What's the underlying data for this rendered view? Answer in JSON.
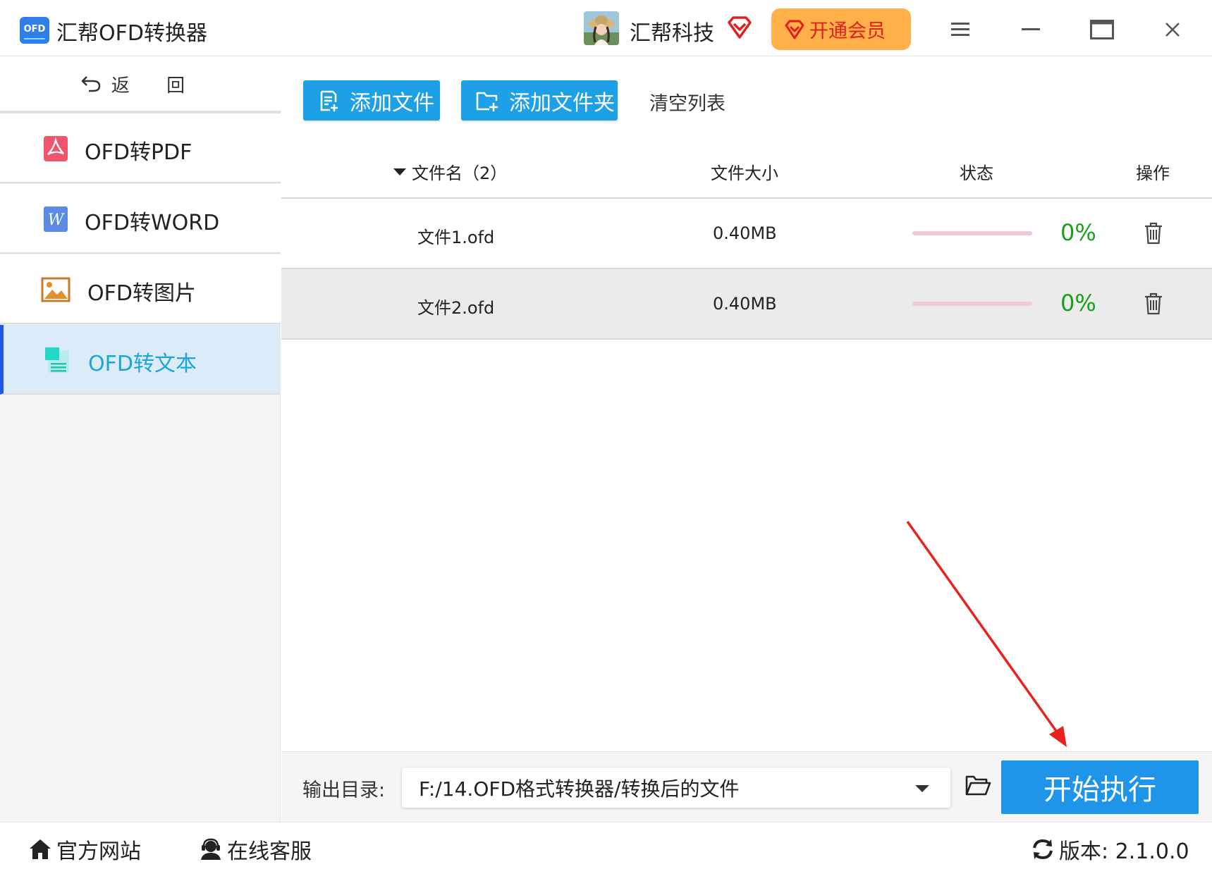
{
  "app": {
    "logo_text": "OFD",
    "title": "汇帮OFD转换器",
    "user_name": "汇帮科技",
    "vip_label": "开通会员"
  },
  "sidebar": {
    "back_label": "返 回",
    "items": [
      {
        "label": "OFD转PDF",
        "icon": "pdf-icon"
      },
      {
        "label": "OFD转WORD",
        "icon": "word-icon"
      },
      {
        "label": "OFD转图片",
        "icon": "image-icon"
      },
      {
        "label": "OFD转文本",
        "icon": "text-file-icon",
        "active": true
      }
    ]
  },
  "toolbar": {
    "add_file": "添加文件",
    "add_folder": "添加文件夹",
    "clear_list": "清空列表"
  },
  "table": {
    "headers": {
      "filename": "文件名（2）",
      "size": "文件大小",
      "status": "状态",
      "action": "操作"
    },
    "rows": [
      {
        "name": "文件1.ofd",
        "size": "0.40MB",
        "progress": 0,
        "progress_text": "0%"
      },
      {
        "name": "文件2.ofd",
        "size": "0.40MB",
        "progress": 0,
        "progress_text": "0%"
      }
    ]
  },
  "output": {
    "label": "输出目录:",
    "path": "F:/14.OFD格式转换器/转换后的文件",
    "start_label": "开始执行"
  },
  "footer": {
    "website": "官方网站",
    "service": "在线客服",
    "version": "版本: 2.1.0.0"
  },
  "colors": {
    "accent_blue": "#1da0e6",
    "start_blue": "#1e95e9",
    "vip_orange": "#ffb048",
    "vip_red": "#e0201e",
    "progress_text_green": "#18a018",
    "progress_track_pink": "#f4c8d6",
    "active_nav_bg": "#dcebf8",
    "annotation_red": "#e8231d"
  }
}
